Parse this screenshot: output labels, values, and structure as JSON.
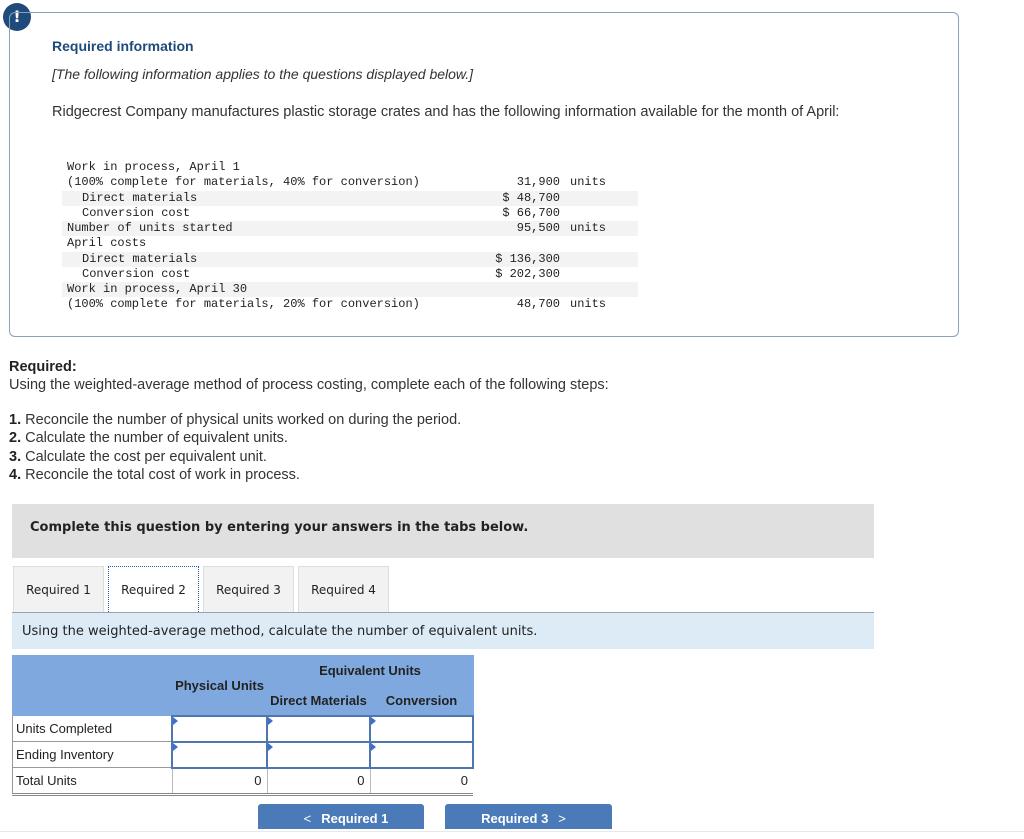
{
  "alert": {
    "icon": "exclamation-icon",
    "glyph": "!"
  },
  "info": {
    "title": "Required information",
    "subtitle": "[The following information applies to the questions displayed below.]",
    "description": "Ridgecrest Company manufactures plastic storage crates and has the following information available for the month of April:",
    "ledger": [
      {
        "label": "Work in process, April 1",
        "indent": false,
        "amount": "",
        "unit": "",
        "shade": false
      },
      {
        "label": "(100% complete for materials, 40% for conversion)",
        "indent": false,
        "amount": "31,900",
        "unit": "units",
        "shade": false
      },
      {
        "label": "Direct materials",
        "indent": true,
        "amount": "$ 48,700",
        "unit": "",
        "shade": true
      },
      {
        "label": "Conversion cost",
        "indent": true,
        "amount": "$ 66,700",
        "unit": "",
        "shade": false
      },
      {
        "label": "Number of units started",
        "indent": false,
        "amount": "95,500",
        "unit": "units",
        "shade": true
      },
      {
        "label": "April costs",
        "indent": false,
        "amount": "",
        "unit": "",
        "shade": false
      },
      {
        "label": "Direct materials",
        "indent": true,
        "amount": "$ 136,300",
        "unit": "",
        "shade": true
      },
      {
        "label": "Conversion cost",
        "indent": true,
        "amount": "$ 202,300",
        "unit": "",
        "shade": false
      },
      {
        "label": "Work in process, April 30",
        "indent": false,
        "amount": "",
        "unit": "",
        "shade": true
      },
      {
        "label": "(100% complete for materials, 20% for conversion)",
        "indent": false,
        "amount": "48,700",
        "unit": "units",
        "shade": false
      }
    ]
  },
  "required": {
    "heading": "Required:",
    "text": "Using the weighted-average method of process costing, complete each of the following steps:",
    "steps": [
      {
        "num": "1.",
        "text": " Reconcile the number of physical units worked on during the period."
      },
      {
        "num": "2.",
        "text": " Calculate the number of equivalent units."
      },
      {
        "num": "3.",
        "text": " Calculate the cost per equivalent unit."
      },
      {
        "num": "4.",
        "text": " Reconcile the total cost of work in process."
      }
    ]
  },
  "banner": "Complete this question by entering your answers in the tabs below.",
  "tabs": [
    {
      "label": "Required 1",
      "active": false
    },
    {
      "label": "Required 2",
      "active": true
    },
    {
      "label": "Required 3",
      "active": false
    },
    {
      "label": "Required 4",
      "active": false
    }
  ],
  "instruction": "Using the weighted-average method, calculate the number of equivalent units.",
  "table": {
    "headers": {
      "physical": "Physical Units",
      "equivalent": "Equivalent Units",
      "direct_materials": "Direct Materials",
      "conversion": "Conversion"
    },
    "rows": [
      {
        "label": "Units Completed",
        "physical": "",
        "direct_materials": "",
        "conversion": ""
      },
      {
        "label": "Ending Inventory",
        "physical": "",
        "direct_materials": "",
        "conversion": ""
      }
    ],
    "total": {
      "label": "Total Units",
      "physical": "0",
      "direct_materials": "0",
      "conversion": "0"
    }
  },
  "nav": {
    "prev_label": "Required 1",
    "prev_icon": "chevron-left-icon",
    "prev_glyph": "<",
    "next_label": "Required 3",
    "next_icon": "chevron-right-icon",
    "next_glyph": ">"
  }
}
